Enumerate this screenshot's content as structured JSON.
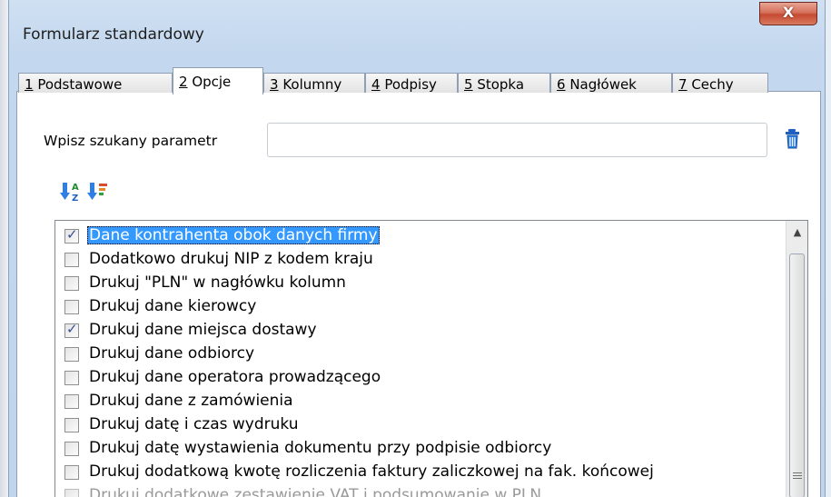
{
  "window": {
    "title": "Formularz standardowy",
    "close_label": "X"
  },
  "tabs": [
    {
      "num": "1",
      "text": " Podstawowe"
    },
    {
      "num": "2",
      "text": " Opcje"
    },
    {
      "num": "3",
      "text": " Kolumny"
    },
    {
      "num": "4",
      "text": " Podpisy"
    },
    {
      "num": "5",
      "text": " Stopka"
    },
    {
      "num": "6",
      "text": " Nagłówek"
    },
    {
      "num": "7",
      "text": " Cechy"
    }
  ],
  "active_tab": "2 Opcje",
  "search": {
    "label": "Wpisz szukany parametr",
    "value": "",
    "placeholder": ""
  },
  "icons": {
    "delete": "trash-icon",
    "sort_az": "sort-az-icon",
    "sort_filter": "sort-filter-icon"
  },
  "options": [
    {
      "label": "Dane kontrahenta obok danych firmy",
      "checked": true,
      "selected": true
    },
    {
      "label": "Dodatkowo drukuj NIP z kodem kraju",
      "checked": false
    },
    {
      "label": "Drukuj \"PLN\" w nagłówku kolumn",
      "checked": false
    },
    {
      "label": "Drukuj dane kierowcy",
      "checked": false
    },
    {
      "label": "Drukuj dane miejsca dostawy",
      "checked": true
    },
    {
      "label": "Drukuj dane odbiorcy",
      "checked": false
    },
    {
      "label": "Drukuj dane operatora prowadzącego",
      "checked": false
    },
    {
      "label": "Drukuj dane z zamówienia",
      "checked": false
    },
    {
      "label": "Drukuj datę i czas wydruku",
      "checked": false
    },
    {
      "label": "Drukuj datę wystawienia dokumentu przy podpisie odbiorcy",
      "checked": false
    },
    {
      "label": "Drukuj dodatkową kwotę rozliczenia faktury zaliczkowej na fak. końcowej",
      "checked": false
    },
    {
      "label": "Drukuj dodatkowe zestawienie VAT i podsumowanie w PLN",
      "checked": false,
      "disabled": true
    }
  ],
  "colors": {
    "selection": "#3399ff",
    "title_bar": "#c3d7ee",
    "close_button": "#c64a31"
  }
}
